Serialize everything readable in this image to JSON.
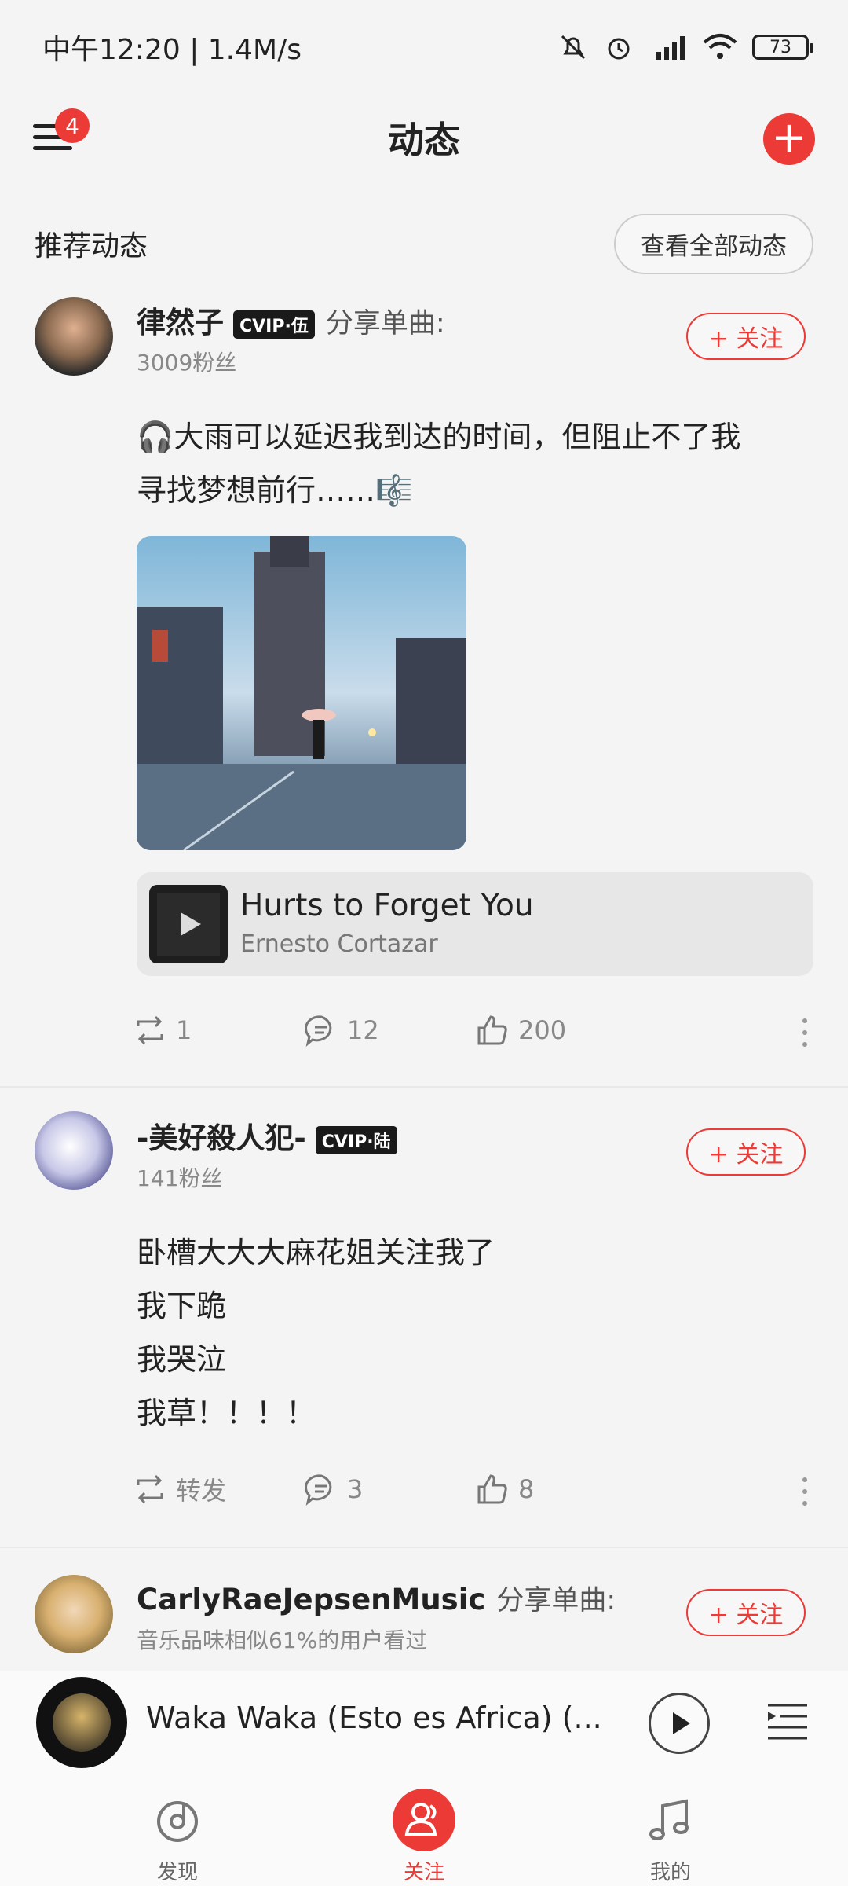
{
  "status_bar": {
    "time_speed": "中午12:20 | 1.4M/s",
    "battery": "73"
  },
  "header": {
    "title": "动态",
    "menu_badge": "4"
  },
  "section": {
    "title": "推荐动态",
    "view_all": "查看全部动态"
  },
  "posts": [
    {
      "username": "律然子",
      "vip": "CVIP·伍",
      "action": "分享单曲:",
      "sub": "3009粉丝",
      "follow": "+ 关注",
      "text_line1": "🎧大雨可以延迟我到达的时间，但阻止不了我",
      "text_line2": "寻找梦想前行……🎼",
      "song_title": "Hurts to Forget You",
      "song_artist": "Ernesto Cortazar",
      "repost": "1",
      "comments": "12",
      "likes": "200"
    },
    {
      "username": "-美好殺人犯-",
      "vip": "CVIP·陆",
      "sub": "141粉丝",
      "follow": "+ 关注",
      "lines": [
        "卧槽大大大麻花姐关注我了",
        "我下跪",
        "我哭泣",
        "我草！！！！"
      ],
      "repost": "转发",
      "comments": "3",
      "likes": "8"
    },
    {
      "username": "CarlyRaeJepsenMusic",
      "action": "分享单曲:",
      "sub": "音乐品味相似61%的用户看过",
      "follow": "+ 关注"
    }
  ],
  "player": {
    "title": "Waka Waka (Esto es Africa) (..."
  },
  "tabs": [
    {
      "label": "发现"
    },
    {
      "label": "关注"
    },
    {
      "label": "我的"
    }
  ],
  "colors": {
    "accent": "#ec3a36",
    "background": "#f4f4f4"
  }
}
